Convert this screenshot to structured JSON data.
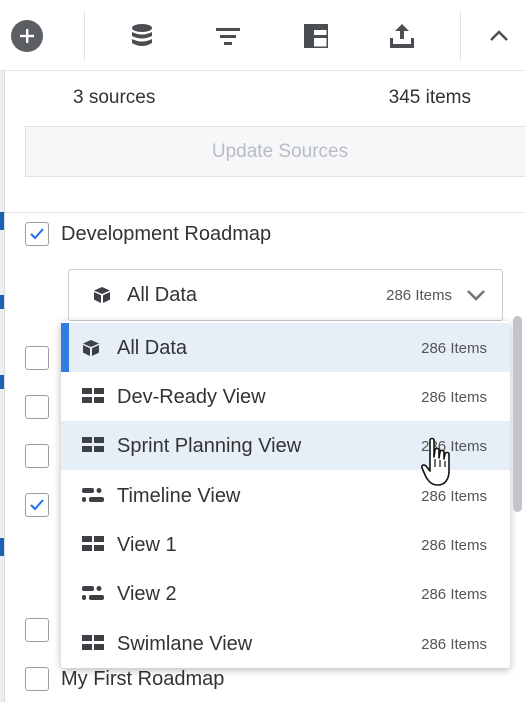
{
  "toolbar": {
    "buttons": [
      {
        "icon": "plus-circle-icon"
      },
      {
        "icon": "database-icon"
      },
      {
        "icon": "filter-icon"
      },
      {
        "icon": "layout-icon"
      },
      {
        "icon": "upload-icon"
      },
      {
        "icon": "chevron-up-icon"
      }
    ]
  },
  "panel": {
    "sources_count": "3 sources",
    "items_count": "345 items",
    "update_button": "Update Sources"
  },
  "roadmaps": [
    {
      "label": "Development Roadmap",
      "checked": true
    },
    {
      "label": "",
      "checked": false
    },
    {
      "label": "",
      "checked": false
    },
    {
      "label": "",
      "checked": false
    },
    {
      "label": "",
      "checked": true
    },
    {
      "label": "",
      "checked": false
    },
    {
      "label": "My First Roadmap",
      "checked": false
    }
  ],
  "view_selector": {
    "selected_label": "All Data",
    "selected_count": "286 Items",
    "icon": "cube-icon"
  },
  "dropdown": {
    "items": [
      {
        "label": "All Data",
        "count": "286 Items",
        "icon": "cube-icon",
        "state": "selected"
      },
      {
        "label": "Dev-Ready View",
        "count": "286 Items",
        "icon": "grid-icon",
        "state": ""
      },
      {
        "label": "Sprint Planning View",
        "count": "286 Items",
        "icon": "grid-icon",
        "state": "hover"
      },
      {
        "label": "Timeline View",
        "count": "286 Items",
        "icon": "timeline-icon",
        "state": ""
      },
      {
        "label": "View 1",
        "count": "286 Items",
        "icon": "grid-icon",
        "state": ""
      },
      {
        "label": "View 2",
        "count": "286 Items",
        "icon": "timeline-icon",
        "state": ""
      },
      {
        "label": "Swimlane View",
        "count": "286 Items",
        "icon": "grid-icon",
        "state": ""
      }
    ]
  },
  "colors": {
    "accent": "#2f7de1",
    "selected_bg": "#e6eef8",
    "icon_dark": "#3d4146",
    "checkbox_check": "#1a73e8"
  }
}
